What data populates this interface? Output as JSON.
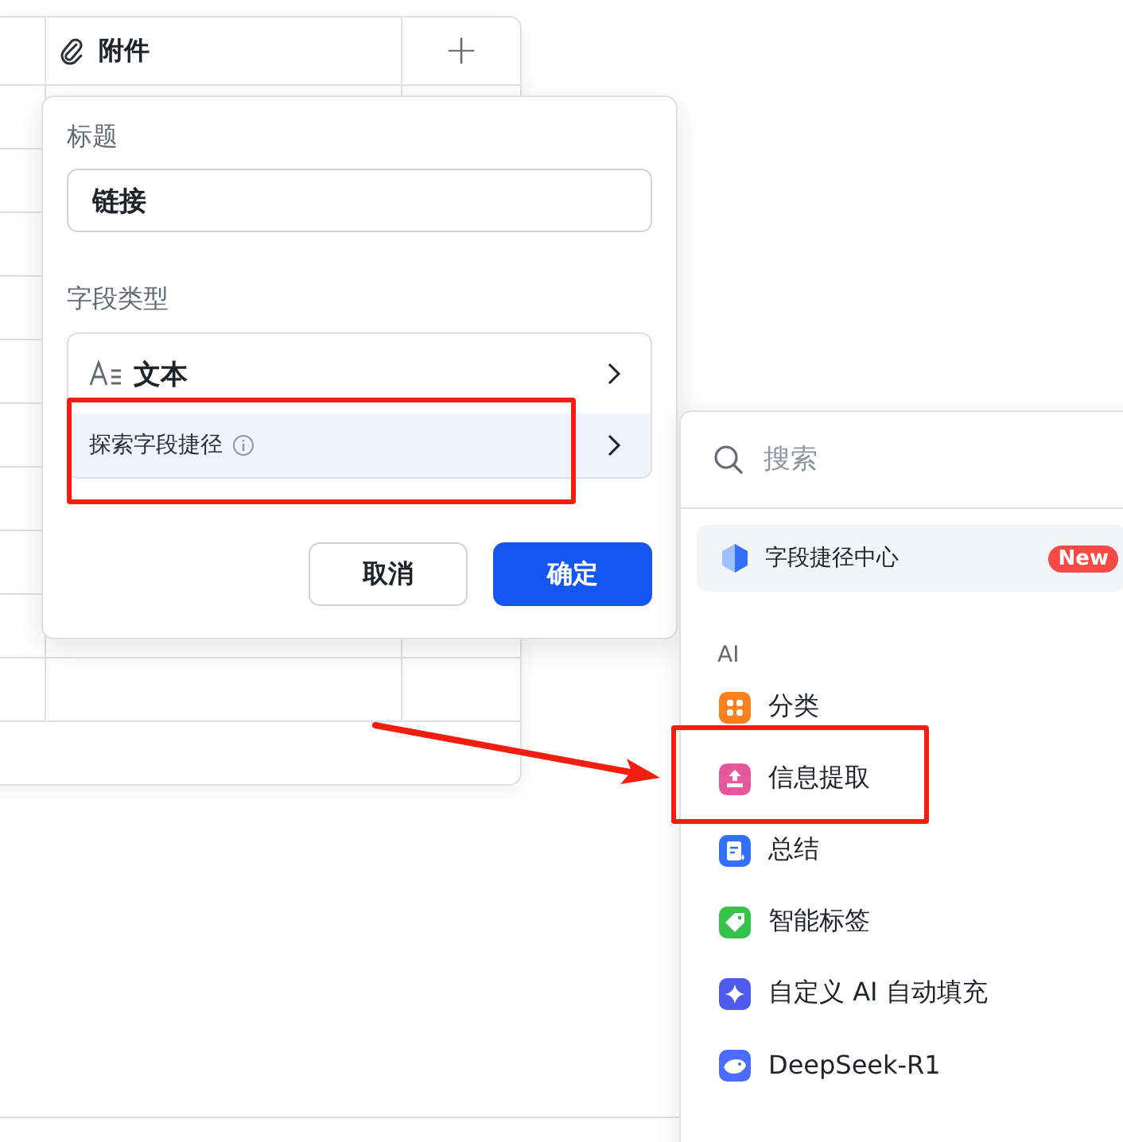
{
  "table": {
    "header": {
      "label": "附件",
      "add": "+"
    }
  },
  "field_dialog": {
    "title_label": "标题",
    "title_value": "链接",
    "type_label": "字段类型",
    "type_options": [
      {
        "kind": "type",
        "label": "文本",
        "selected": false
      },
      {
        "kind": "explore",
        "label": "探索字段捷径",
        "selected": true
      }
    ],
    "buttons": [
      {
        "kind": "secondary",
        "label": "取消"
      },
      {
        "kind": "primary",
        "label": "确定"
      }
    ]
  },
  "shortcut_menu": {
    "search": {
      "placeholder": "搜索"
    },
    "featured": {
      "label": "字段捷径中心",
      "badge": "New"
    },
    "sections": [
      {
        "title": "AI",
        "items": [
          {
            "label": "分类",
            "color": "#f7811e"
          },
          {
            "label": "信息提取",
            "color": "#e5589c"
          },
          {
            "label": "总结",
            "color": "#3370ff"
          },
          {
            "label": "智能标签",
            "color": "#34c24a"
          },
          {
            "label": "自定义 AI 自动填充",
            "color": "#4f5bed"
          },
          {
            "label": "DeepSeek-R1",
            "color": "#4d6bfe"
          }
        ]
      }
    ]
  }
}
